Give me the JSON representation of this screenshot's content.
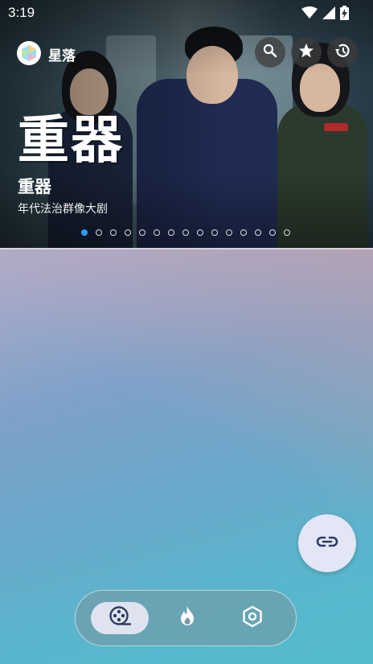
{
  "status_bar": {
    "time": "3:19",
    "icons": [
      "wifi-icon",
      "cellular-signal-icon",
      "battery-charging-icon"
    ]
  },
  "app": {
    "name": "星落",
    "logo_icon": "app-logo-icon"
  },
  "top_actions": [
    {
      "name": "search-button",
      "icon": "search-icon"
    },
    {
      "name": "favorites-button",
      "icon": "star-icon"
    },
    {
      "name": "history-button",
      "icon": "history-icon"
    }
  ],
  "banner": {
    "title_art": "重器",
    "title": "重器",
    "subtitle": "年代法治群像大剧",
    "total_slides": 15,
    "active_slide": 1
  },
  "fab": {
    "icon": "link-icon"
  },
  "bottom_nav": {
    "items": [
      {
        "name": "nav-film",
        "icon": "film-reel-icon",
        "selected": true
      },
      {
        "name": "nav-hot",
        "icon": "flame-icon",
        "selected": false
      },
      {
        "name": "nav-settings",
        "icon": "hexagon-settings-icon",
        "selected": false
      }
    ]
  },
  "colors": {
    "accent": "#2a9df4",
    "nav_selected_bg": "#dfe3f0",
    "icon_dark": "#2e3d62"
  }
}
